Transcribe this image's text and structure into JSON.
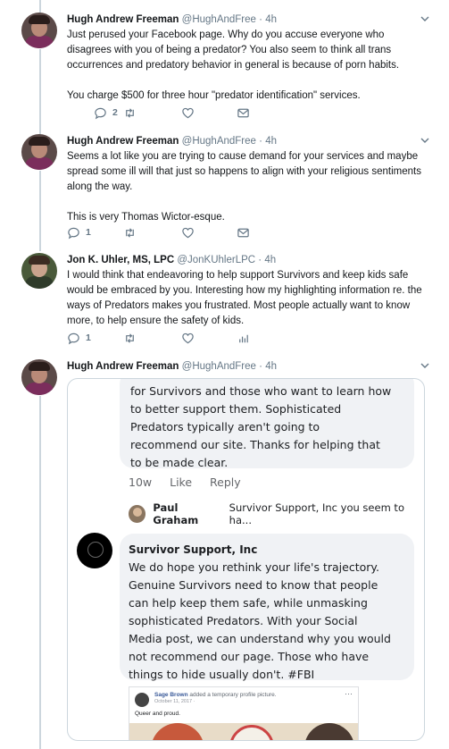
{
  "tweets": [
    {
      "name": "Hugh Andrew Freeman",
      "handle": "@HughAndFree",
      "dot": "·",
      "time": "4h",
      "paragraphs": [
        "Just perused your Facebook page. Why do you accuse everyone who disagrees with you of being a predator? You also seem to think all trans occurrences and predatory behavior in general is because of porn habits.",
        "You charge $500 for three hour \"predator identification\" services."
      ],
      "reply_count": "2"
    },
    {
      "name": "Hugh Andrew Freeman",
      "handle": "@HughAndFree",
      "dot": "·",
      "time": "4h",
      "paragraphs": [
        "Seems a lot like you are trying to cause demand for your services and maybe spread some ill will that just so happens to align with your religious sentiments along the way.",
        "This is very Thomas Wictor-esque."
      ],
      "reply_count": "1"
    },
    {
      "name": "Jon K. Uhler, MS, LPC",
      "handle": "@JonKUhlerLPC",
      "dot": "·",
      "time": "4h",
      "paragraphs": [
        "I would think that endeavoring to help support Survivors and keep kids safe would be embraced by you. Interesting how my highlighting information re. the ways of Predators makes you frustrated. Most people actually want to know more, to help ensure the safety of kids."
      ],
      "reply_count": "1"
    },
    {
      "name": "Hugh Andrew Freeman",
      "handle": "@HughAndFree",
      "dot": "·",
      "time": "4h"
    }
  ],
  "embed": {
    "bubble1_lines": [
      "for Survivors and those who want to learn how",
      "to better support them. Sophisticated",
      "Predators typically aren't going to",
      "recommend our site. Thanks for helping that",
      "to be made clear."
    ],
    "time": "10w",
    "like": "Like",
    "reply": "Reply",
    "reply_name": "Paul Graham",
    "reply_snippet": "Survivor Support, Inc you seem to ha...",
    "page_name": "Survivor Support, Inc",
    "bubble2_lines": [
      "We do hope you rethink your life's trajectory.",
      "Genuine Survivors need to know that people",
      "can help keep them safe, while unmasking",
      "sophisticated Predators. With your Social",
      "Media post, we can understand why you would",
      "not recommend our page. Those who have",
      "things to hide usually don't. #FBI"
    ],
    "inner_post": {
      "author": "Sage Brown",
      "action": "added a temporary profile picture.",
      "date": "October 11, 2017 · ",
      "more": "···",
      "text": "Queer and proud."
    }
  },
  "icons": [
    "reply-icon",
    "retweet-icon",
    "like-icon",
    "message-icon",
    "analytics-icon",
    "caret-down-icon"
  ],
  "colors": {
    "gray": "#657786",
    "thread": "#ccd6dd",
    "fb_bubble": "#f0f2f5"
  }
}
